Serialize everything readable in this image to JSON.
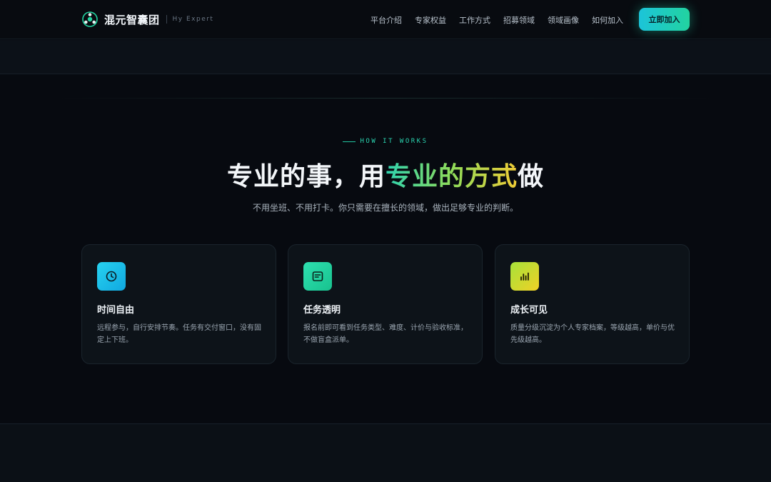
{
  "brand": {
    "name": "混元智囊团",
    "sub": "Hy Expert",
    "logo_icon": "tri-node-logo-icon"
  },
  "nav": {
    "items": [
      "平台介绍",
      "专家权益",
      "工作方式",
      "招募领域",
      "领域画像",
      "如何加入"
    ],
    "cta_label": "立即加入"
  },
  "hero": {
    "eyebrow": "HOW IT WORKS",
    "title_plain": "专业的事，用",
    "title_highlight": "专业的方式",
    "title_end": "做",
    "subtitle": "不用坐班、不用打卡。你只需要在擅长的领域，做出足够专业的判断。"
  },
  "cards": [
    {
      "icon": "clock-icon",
      "title": "时间自由",
      "desc": "远程参与，自行安排节奏。任务有交付窗口，没有固定上下班。"
    },
    {
      "icon": "document-icon",
      "title": "任务透明",
      "desc": "报名前即可看到任务类型、难度、计价与验收标准，不做盲盒派单。"
    },
    {
      "icon": "bar-chart-icon",
      "title": "成长可见",
      "desc": "质量分级沉淀为个人专家档案，等级越高，单价与优先级越高。"
    }
  ],
  "colors": {
    "accent_teal": "#22d3a0",
    "accent_cyan": "#1cc4d9",
    "accent_yellow": "#f1cd36",
    "background": "#070a10"
  }
}
